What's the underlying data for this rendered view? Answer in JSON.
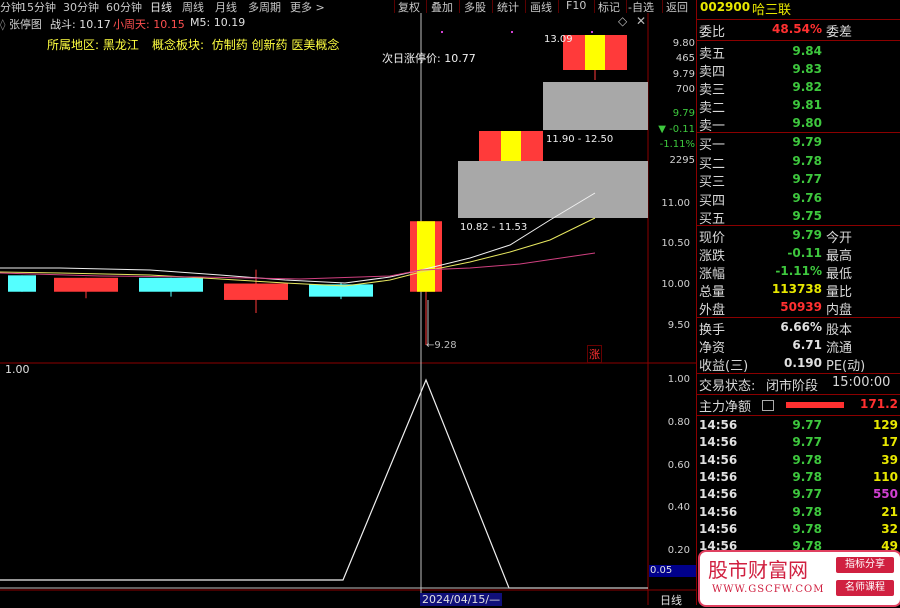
{
  "toolbar": {
    "left_items": [
      "分钟",
      "15分钟",
      "30分钟",
      "60分钟",
      "日线",
      "周线",
      "月线",
      "多周期",
      "更多 >"
    ],
    "active": "日线",
    "right_items": [
      "复权",
      "叠加",
      "多股",
      "统计",
      "画线",
      "F10",
      "标记",
      "-自选",
      "返回"
    ]
  },
  "chart_header": {
    "name": "张停图",
    "label_a": "战斗:",
    "value_a": "10.17",
    "label_b": "小周天:",
    "value_b": "10.15",
    "label_c": "M5:",
    "value_c": "10.19"
  },
  "info_line": {
    "region_label": "所属地区:",
    "region": "黑龙江",
    "concept_label": "概念板块:",
    "concepts": "仿制药 创新药 医美概念"
  },
  "annotations": {
    "next_limit": "次日涨停价: 10.77",
    "range_1": "10.82 - 11.53",
    "range_2": "11.90 - 12.50",
    "top_value": "13.09",
    "low_mark": "9.28",
    "zhang": "涨"
  },
  "price_axis": [
    "11.00",
    "10.50",
    "10.00",
    "9.50"
  ],
  "mini_axis": [
    "9.80",
    "465",
    "9.79",
    "700",
    "9.79",
    "▼ -0.11",
    "-1.11%",
    "2295"
  ],
  "indicator": {
    "left_label": "1.00",
    "axis": [
      "1.00",
      "0.80",
      "0.60",
      "0.40",
      "0.20"
    ],
    "current_value": "0.05",
    "date_label": "2024/04/15/—",
    "period_label": "日线"
  },
  "chart_data": {
    "type": "candlestick",
    "yrange": [
      9.2,
      11.4
    ],
    "candles": [
      {
        "open": 9.93,
        "close": 10.13,
        "high": 10.13,
        "low": 9.93,
        "color": "cyan"
      },
      {
        "open": 10.1,
        "close": 9.93,
        "high": 10.1,
        "low": 9.85,
        "color": "red"
      },
      {
        "open": 9.93,
        "close": 10.1,
        "high": 10.1,
        "low": 9.87,
        "color": "cyan"
      },
      {
        "open": 10.03,
        "close": 9.83,
        "high": 10.2,
        "low": 9.67,
        "color": "red"
      },
      {
        "open": 9.87,
        "close": 10.02,
        "high": 10.04,
        "low": 9.84,
        "color": "cyan"
      },
      {
        "open": 9.93,
        "close": 10.79,
        "high": 10.79,
        "low": 9.28,
        "color": "red"
      }
    ],
    "zones": [
      {
        "low": 10.82,
        "high": 11.53
      },
      {
        "low": 11.9,
        "high": 12.5
      }
    ],
    "indicator_series": [
      0.05,
      0.05,
      0.05,
      0.05,
      0.05,
      1.0,
      0.05,
      0.05
    ]
  },
  "quote": {
    "code": "002900",
    "name": "哈三联",
    "weibi_label": "委比",
    "weibi": "48.54%",
    "weicha_label": "委差",
    "sells": [
      {
        "label": "卖五",
        "price": "9.84"
      },
      {
        "label": "卖四",
        "price": "9.83"
      },
      {
        "label": "卖三",
        "price": "9.82"
      },
      {
        "label": "卖二",
        "price": "9.81"
      },
      {
        "label": "卖一",
        "price": "9.80"
      }
    ],
    "buys": [
      {
        "label": "买一",
        "price": "9.79"
      },
      {
        "label": "买二",
        "price": "9.78"
      },
      {
        "label": "买三",
        "price": "9.77"
      },
      {
        "label": "买四",
        "price": "9.76"
      },
      {
        "label": "买五",
        "price": "9.75"
      }
    ],
    "stats": [
      {
        "label": "现价",
        "value": "9.79",
        "color": "#3ec83e",
        "right": "今开"
      },
      {
        "label": "涨跌",
        "value": "-0.11",
        "color": "#3ec83e",
        "right": "最高"
      },
      {
        "label": "涨幅",
        "value": "-1.11%",
        "color": "#3ec83e",
        "right": "最低"
      },
      {
        "label": "总量",
        "value": "113738",
        "color": "#e8e800",
        "right": "量比"
      },
      {
        "label": "外盘",
        "value": "50939",
        "color": "#ff3030",
        "right": "内盘"
      }
    ],
    "stats2": [
      {
        "label": "换手",
        "value": "6.66%",
        "right": "股本"
      },
      {
        "label": "净资",
        "value": "6.71",
        "right": "流通"
      },
      {
        "label": "收益(三)",
        "value": "0.190",
        "right": "PE(动)"
      }
    ],
    "trade_status_label": "交易状态:",
    "trade_status": "闭市阶段",
    "trade_time": "15:00:00",
    "net_label": "主力净额",
    "net_value": "171.2",
    "ticks": [
      {
        "time": "14:56",
        "price": "9.77",
        "vol": "129",
        "vcolor": "#e8e800"
      },
      {
        "time": "14:56",
        "price": "9.77",
        "vol": "17",
        "vcolor": "#e8e800"
      },
      {
        "time": "14:56",
        "price": "9.78",
        "vol": "39",
        "vcolor": "#e8e800"
      },
      {
        "time": "14:56",
        "price": "9.78",
        "vol": "110",
        "vcolor": "#e8e800"
      },
      {
        "time": "14:56",
        "price": "9.77",
        "vol": "550",
        "vcolor": "#d040d0"
      },
      {
        "time": "14:56",
        "price": "9.78",
        "vol": "21",
        "vcolor": "#e8e800"
      },
      {
        "time": "14:56",
        "price": "9.78",
        "vol": "32",
        "vcolor": "#e8e800"
      },
      {
        "time": "14:56",
        "price": "9.78",
        "vol": "49",
        "vcolor": "#e8e800"
      }
    ]
  },
  "watermark": {
    "title": "股市财富网",
    "url": "WWW.GSCFW.COM",
    "btn1": "指标分享",
    "btn2": "名师课程"
  }
}
